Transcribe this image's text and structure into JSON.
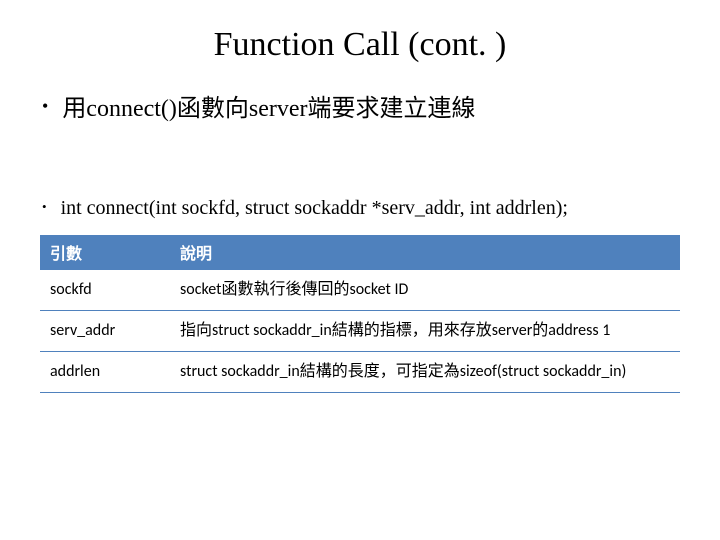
{
  "title": "Function Call (cont. )",
  "bullets": {
    "main": "用connect()函數向server端要求建立連線",
    "signature": "int connect(int sockfd, struct sockaddr *serv_addr, int addrlen);"
  },
  "table": {
    "headers": [
      "引數",
      "說明"
    ],
    "rows": [
      {
        "param": "sockfd",
        "desc": "socket函數執行後傳回的socket ID"
      },
      {
        "param": "serv_addr",
        "desc": "指向struct sockaddr_in結構的指標，用來存放server的address 1"
      },
      {
        "param": "addrlen",
        "desc": "struct sockaddr_in結構的長度，可指定為sizeof(struct sockaddr_in)"
      }
    ]
  }
}
